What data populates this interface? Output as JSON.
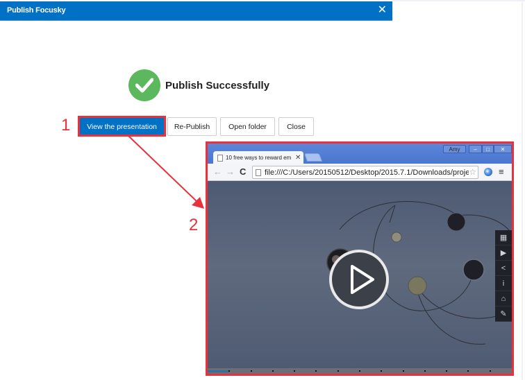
{
  "dialog": {
    "title": "Publish Focusky",
    "close_glyph": "✕",
    "status_message": "Publish Successfully",
    "status_icon": "check-circle-icon",
    "status_color": "#5cb85c",
    "accent_color": "#0071c5",
    "buttons": {
      "view": "View the presentation",
      "republish": "Re-Publish",
      "open_folder": "Open folder",
      "close": "Close"
    }
  },
  "annotations": {
    "step1": "1",
    "step2": "2",
    "color": "#e8313a"
  },
  "browser": {
    "tab_title": "10 free ways to reward em",
    "tab_close": "✕",
    "user_label": "Amy",
    "win_min": "–",
    "win_max": "□",
    "win_close": "✕",
    "back_glyph": "←",
    "forward_glyph": "→",
    "reload_glyph": "C",
    "url": "file:///C:/Users/20150512/Desktop/2015.7.1/Downloads/proje",
    "star_glyph": "☆",
    "menu_glyph": "≡",
    "side_toolbar": [
      {
        "icon": "grid-icon",
        "glyph": "▦"
      },
      {
        "icon": "play-icon",
        "glyph": "▶"
      },
      {
        "icon": "share-icon",
        "glyph": "<"
      },
      {
        "icon": "info-icon",
        "glyph": "i"
      },
      {
        "icon": "home-icon",
        "glyph": "⌂"
      },
      {
        "icon": "edit-icon",
        "glyph": "✎"
      }
    ],
    "progress": {
      "fraction": 0.07,
      "markers": 13
    }
  }
}
